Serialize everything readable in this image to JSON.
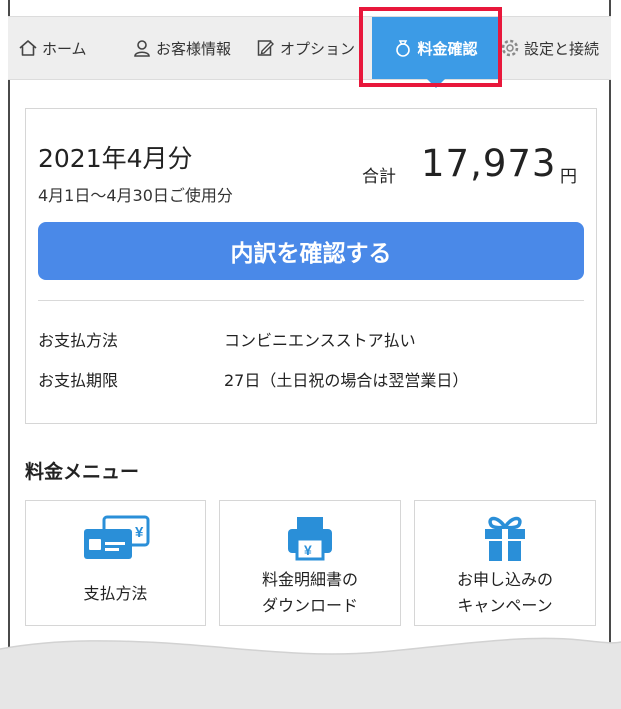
{
  "nav": {
    "items": [
      {
        "label": "ホーム",
        "icon": "home-icon"
      },
      {
        "label": "お客様情報",
        "icon": "user-icon"
      },
      {
        "label": "オプション",
        "icon": "edit-icon"
      },
      {
        "label": "料金確認",
        "icon": "coin-bag-icon",
        "active": true
      },
      {
        "label": "設定と接続",
        "icon": "gear-icon"
      }
    ]
  },
  "billing": {
    "month": "2021年4月分",
    "period": "4月1日～4月30日ご使用分",
    "total_label": "合計",
    "total_amount": "17,973",
    "total_unit": "円",
    "detail_button": "内訳を確認する",
    "rows": [
      {
        "label": "お支払方法",
        "value": "コンビニエンスストア払い"
      },
      {
        "label": "お支払期限",
        "value": "27日（土日祝の場合は翌営業日）"
      }
    ]
  },
  "menu": {
    "title": "料金メニュー",
    "tiles": [
      {
        "label": "支払方法",
        "icon": "credit-cards-icon"
      },
      {
        "label": "料金明細書の\nダウンロード",
        "icon": "printer-icon"
      },
      {
        "label": "お申し込みの\nキャンペーン",
        "icon": "gift-icon"
      }
    ]
  },
  "colors": {
    "accent": "#3c9be6",
    "button": "#4a89e8",
    "highlight": "#e8173b",
    "icon": "#2a8fd8"
  }
}
